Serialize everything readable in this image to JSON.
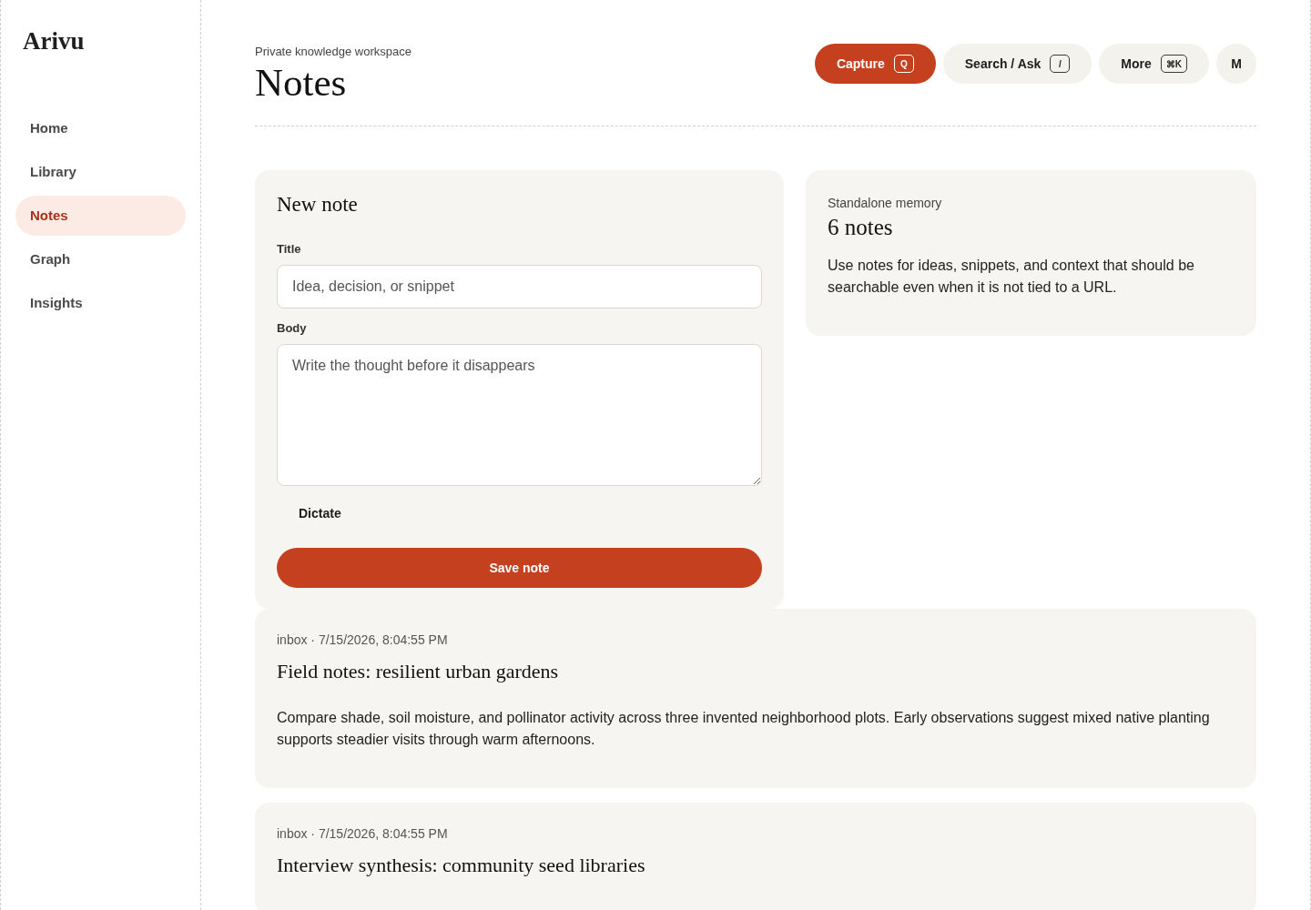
{
  "sidebar": {
    "logo": "Arivu",
    "items": [
      {
        "label": "Home",
        "selected": false
      },
      {
        "label": "Library",
        "selected": false
      },
      {
        "label": "Notes",
        "selected": true
      },
      {
        "label": "Graph",
        "selected": false
      },
      {
        "label": "Insights",
        "selected": false
      }
    ]
  },
  "header": {
    "eyebrow": "Private knowledge workspace",
    "title": "Notes",
    "actions": [
      {
        "kind": "primary",
        "label": "Capture",
        "shortcut": "Q"
      },
      {
        "kind": "secondary",
        "label": "Search / Ask",
        "shortcut": "/"
      },
      {
        "kind": "secondary",
        "label": "More",
        "shortcut": "⌘K"
      },
      {
        "kind": "avatar",
        "label": "M"
      }
    ]
  },
  "new_note": {
    "heading": "New note",
    "fields": [
      {
        "kind": "input",
        "label": "Title",
        "placeholder": "Idea, decision, or snippet"
      },
      {
        "kind": "textarea",
        "label": "Body",
        "placeholder": "Write the thought before it disappears"
      }
    ],
    "dictate_button": "Dictate",
    "save_button": "Save note"
  },
  "summary": {
    "eyebrow": "Standalone memory",
    "count": "6 notes",
    "description": "Use notes for ideas, snippets, and context that should be searchable even when it is not tied to a URL."
  },
  "notes": [
    {
      "meta": "inbox · 7/15/2026, 8:04:55 PM",
      "title": "Field notes: resilient urban gardens",
      "body": "Compare shade, soil moisture, and pollinator activity across three invented neighborhood plots. Early observations suggest mixed native planting supports steadier visits through warm afternoons."
    },
    {
      "meta": "inbox · 7/15/2026, 8:04:55 PM",
      "title": "Interview synthesis: community seed libraries"
    }
  ]
}
